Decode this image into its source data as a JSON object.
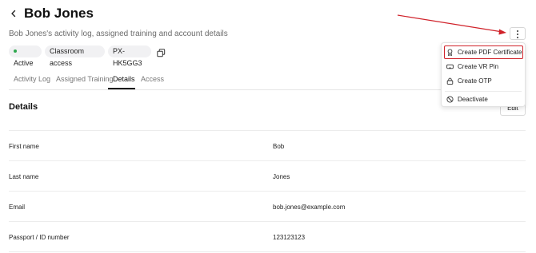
{
  "header": {
    "back_icon": "chevron-left-icon",
    "title": "Bob Jones",
    "subtitle": "Bob Jones's activity log, assigned training and account details"
  },
  "badges": {
    "status": "Active",
    "status_color": "#2fa84f",
    "access": "Classroom access",
    "user_id": "PX-HK5GG3",
    "copy_icon": "copy-icon"
  },
  "tabs": [
    {
      "label": "Activity Log"
    },
    {
      "label": "Assigned Training"
    },
    {
      "label": "Details"
    },
    {
      "label": "Access"
    }
  ],
  "active_tab": "Details",
  "details": {
    "section_title": "Details",
    "edit_label": "Edit",
    "rows": [
      {
        "label": "First name",
        "value": "Bob"
      },
      {
        "label": "Last name",
        "value": "Jones"
      },
      {
        "label": "Email",
        "value": "bob.jones@example.com"
      },
      {
        "label": "Passport / ID number",
        "value": "123123123"
      }
    ]
  },
  "more_menu": {
    "trigger_icon": "more-vertical-icon",
    "items": [
      {
        "label": "Create PDF Certificate",
        "icon": "certificate-icon"
      },
      {
        "label": "Create VR Pin",
        "icon": "vr-headset-icon"
      },
      {
        "label": "Create OTP",
        "icon": "lock-icon"
      },
      {
        "label": "Deactivate",
        "icon": "block-icon"
      }
    ]
  },
  "annotation": {
    "color": "#d0222a"
  }
}
